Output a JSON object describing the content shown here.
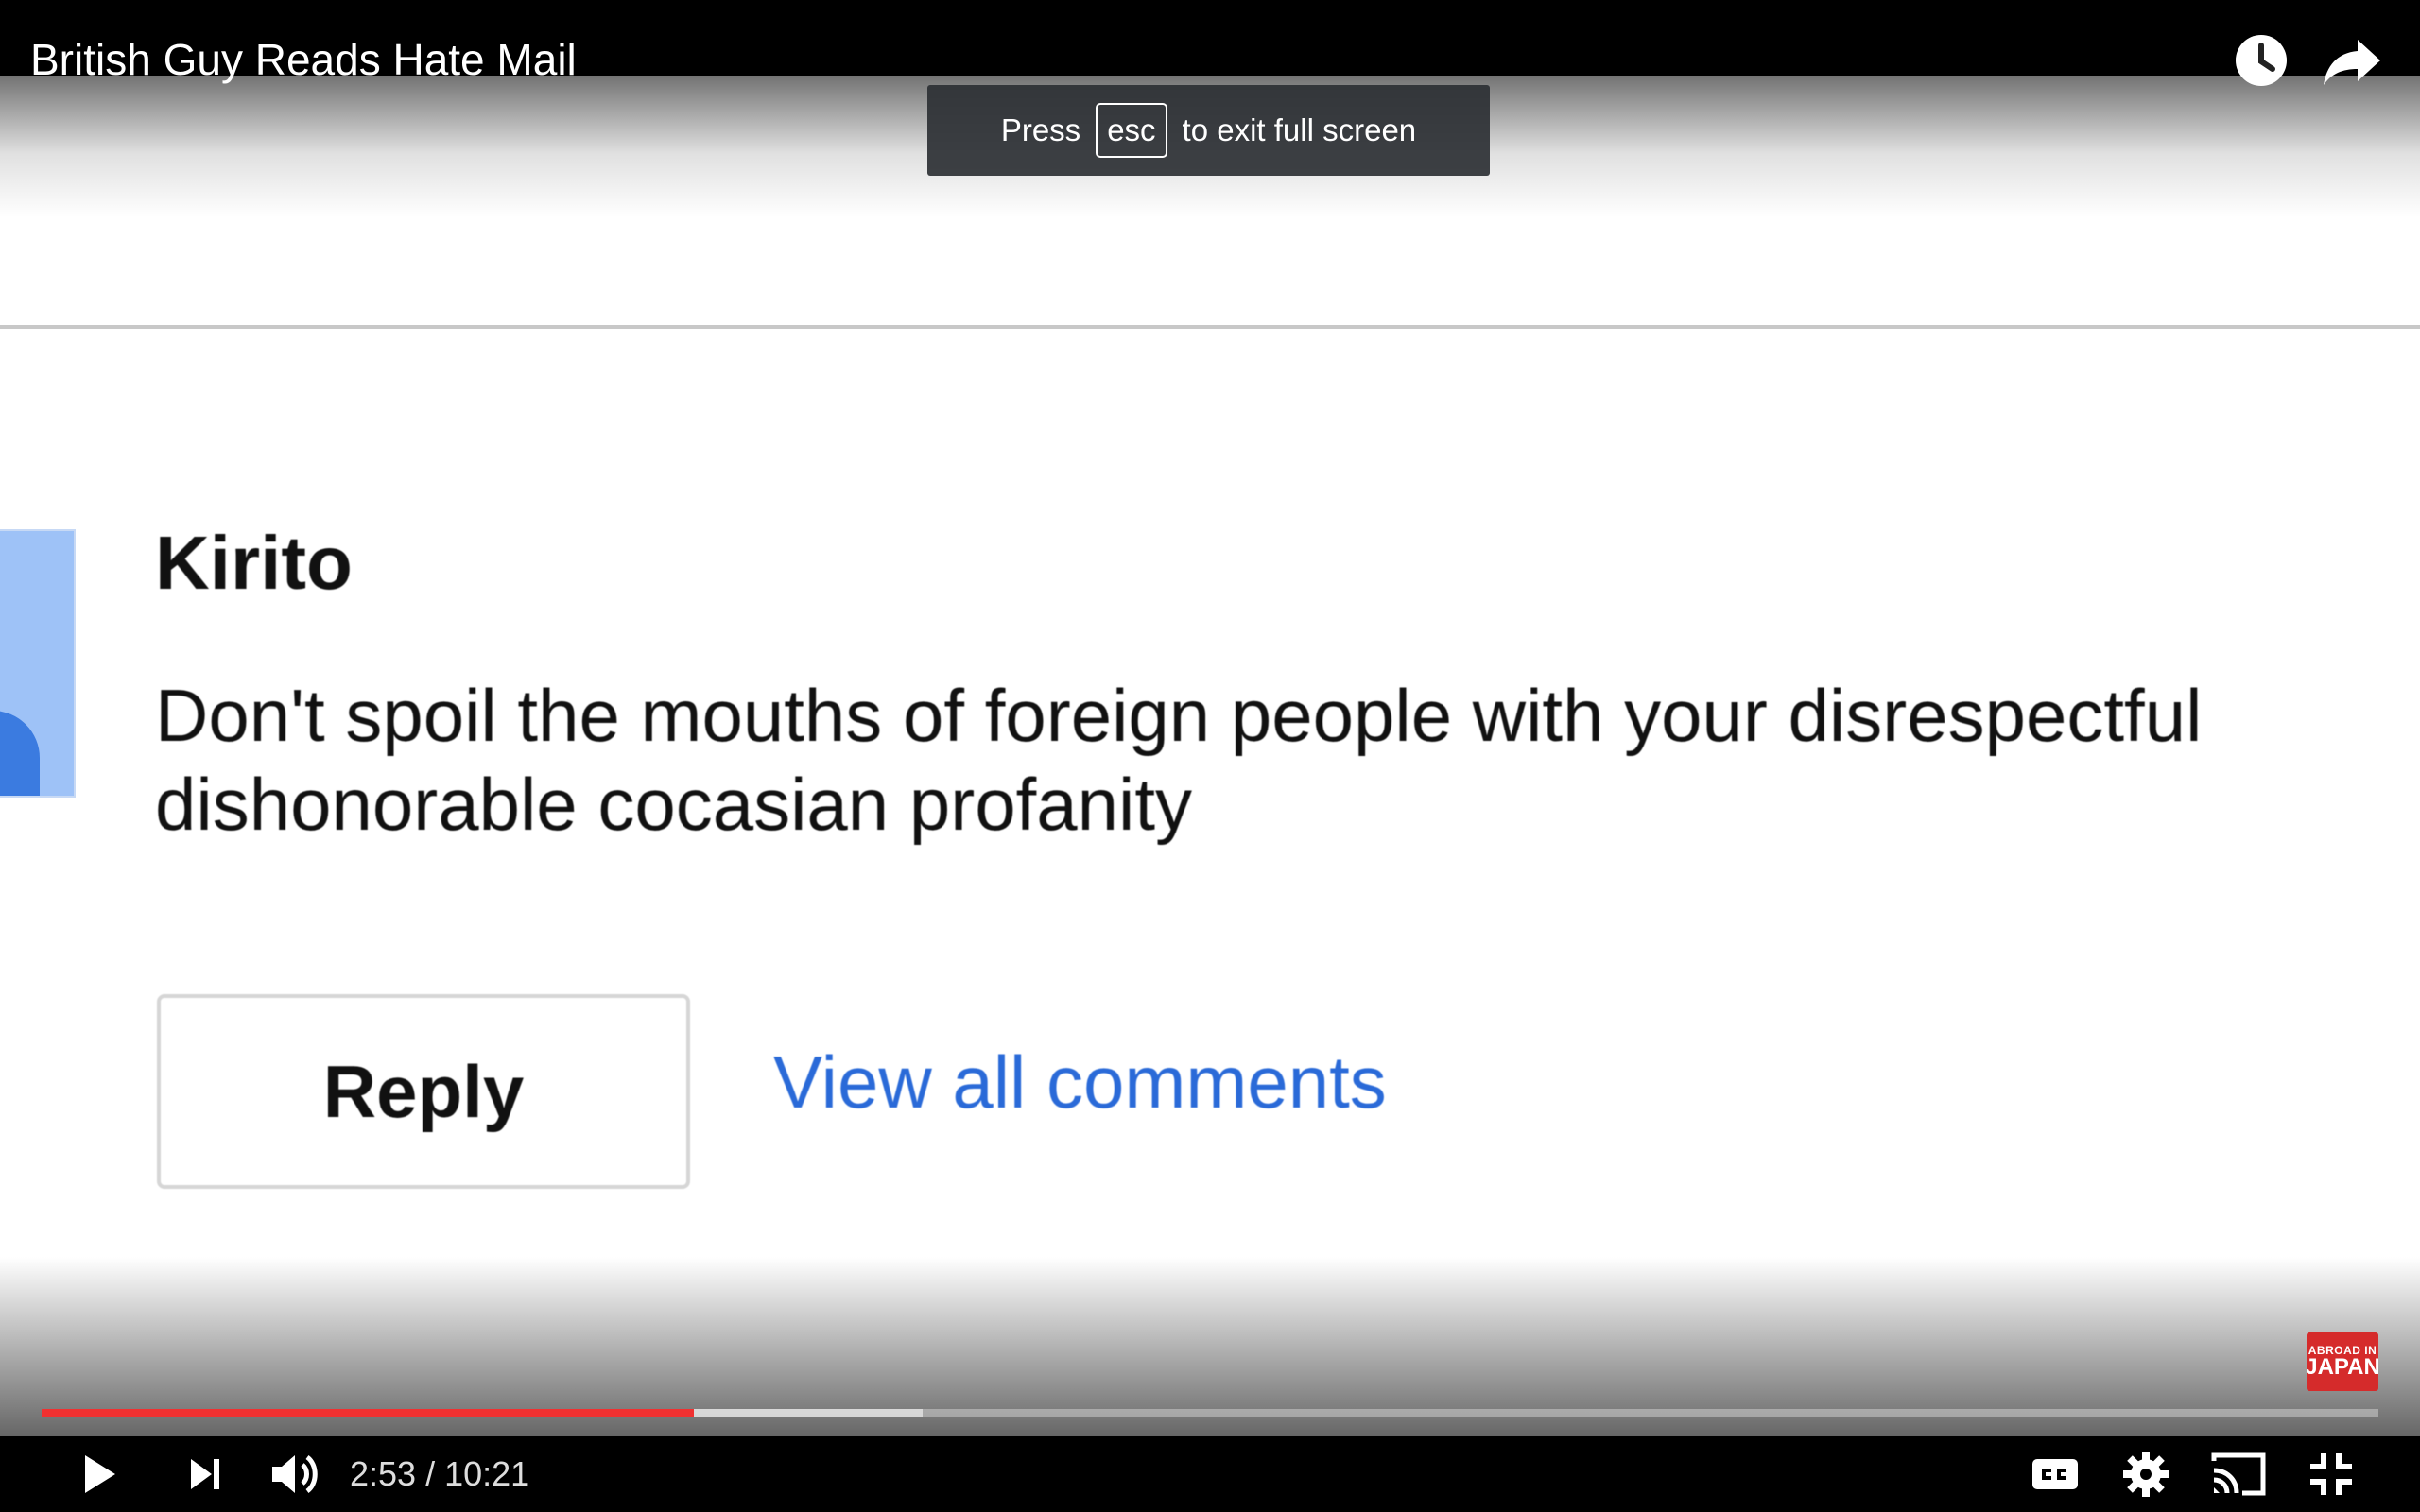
{
  "header": {
    "title": "British Guy Reads Hate Mail"
  },
  "toast": {
    "before": "Press",
    "key": "esc",
    "after": "to exit full screen"
  },
  "video_content": {
    "author": "Kirito",
    "comment": "Don't spoil the mouths of foreign people with your disrespectful dishonorable cocasian profanity",
    "reply_label": "Reply",
    "view_all_label": "View all comments"
  },
  "watermark": {
    "line1": "ABROAD IN",
    "line2": "JAPAN"
  },
  "player": {
    "current_time": "2:53",
    "duration": "10:21",
    "time_display": "2:53 / 10:21",
    "progress_fraction": 0.279,
    "buffered_fraction": 0.377,
    "accent_color": "#f03131"
  },
  "icons": {
    "watch_later": "clock-icon",
    "share": "share-icon",
    "play": "play-icon",
    "next": "next-icon",
    "volume": "volume-icon",
    "captions": "cc-icon",
    "settings": "gear-icon",
    "cast": "cast-icon",
    "exit_fullscreen": "exit-fullscreen-icon"
  }
}
